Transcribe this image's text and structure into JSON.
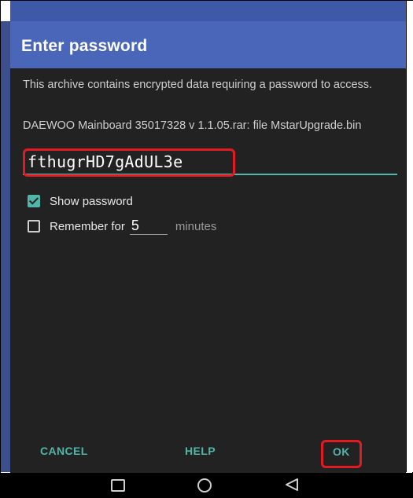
{
  "dialog": {
    "title": "Enter password",
    "message": "This archive contains encrypted data requiring a password to access.",
    "file_info": "DAEWOO Mainboard 35017328 v 1.1.05.rar: file MstarUpgrade.bin",
    "password_value": "fthugrHD7gAdUL3e",
    "show_password_label": "Show password",
    "show_password_checked": true,
    "remember_label": "Remember for",
    "remember_checked": false,
    "remember_minutes": "5",
    "minutes_label": "minutes",
    "buttons": {
      "cancel": "CANCEL",
      "help": "HELP",
      "ok": "OK"
    }
  },
  "colors": {
    "accent": "#4fb6a9",
    "title_bar": "#4a66b8",
    "dialog_bg": "#222222",
    "highlight": "#e11b22"
  },
  "nav_icons": [
    "recent-apps-icon",
    "home-icon",
    "back-icon"
  ]
}
